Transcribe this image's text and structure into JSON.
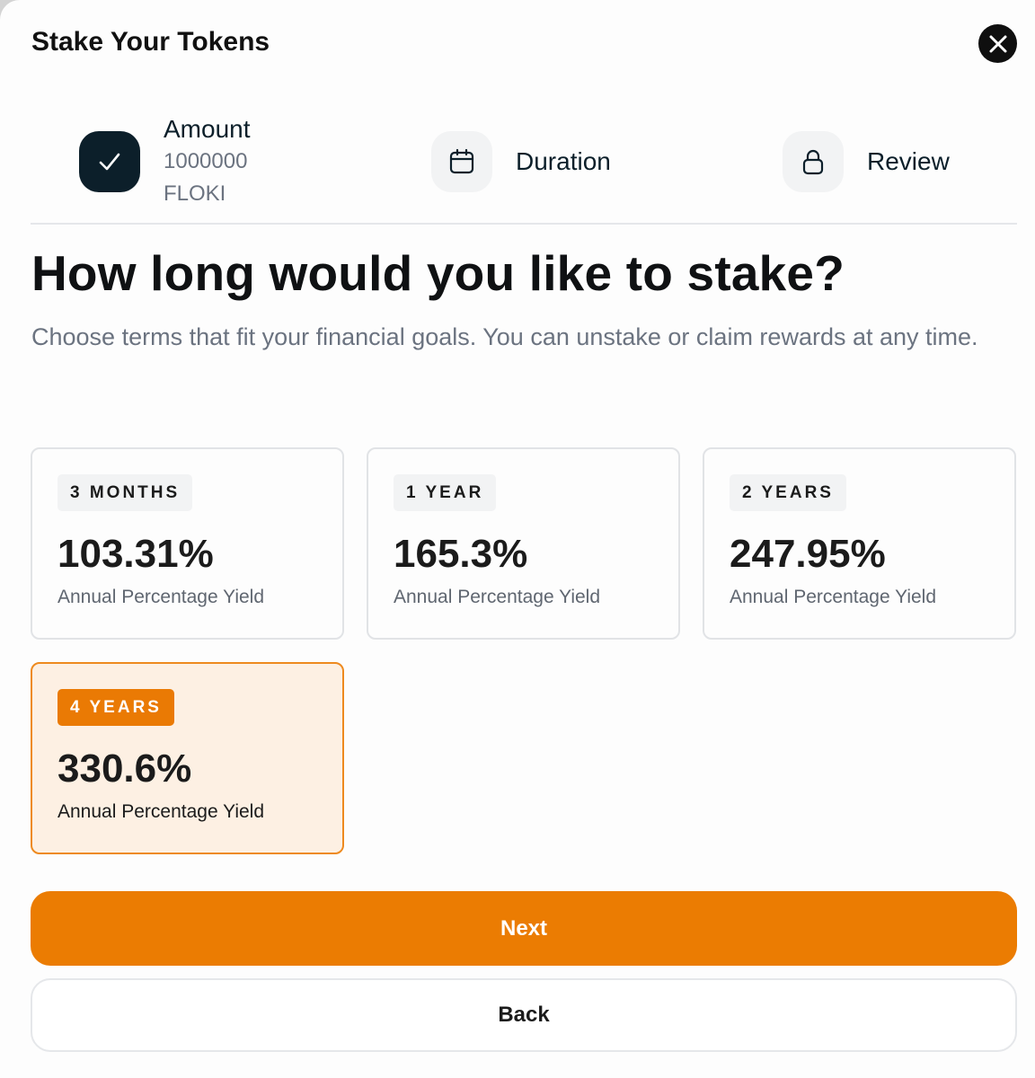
{
  "header": {
    "title": "Stake Your Tokens",
    "close_icon": "close-icon"
  },
  "steps": [
    {
      "label": "Amount",
      "sub_value": "1000000",
      "sub_unit": "FLOKI",
      "icon": "check-icon",
      "state": "done"
    },
    {
      "label": "Duration",
      "icon": "calendar-icon",
      "state": "current"
    },
    {
      "label": "Review",
      "icon": "lock-icon",
      "state": "upcoming"
    }
  ],
  "main": {
    "heading": "How long would you like to stake?",
    "subheading": "Choose terms that fit your financial goals. You can unstake or claim rewards at any time."
  },
  "options": [
    {
      "term": "3 MONTHS",
      "apy": "103.31%",
      "apy_label": "Annual Percentage Yield",
      "selected": false
    },
    {
      "term": "1 YEAR",
      "apy": "165.3%",
      "apy_label": "Annual Percentage Yield",
      "selected": false
    },
    {
      "term": "2 YEARS",
      "apy": "247.95%",
      "apy_label": "Annual Percentage Yield",
      "selected": false
    },
    {
      "term": "4 YEARS",
      "apy": "330.6%",
      "apy_label": "Annual Percentage Yield",
      "selected": true
    }
  ],
  "actions": {
    "next_label": "Next",
    "back_label": "Back"
  },
  "colors": {
    "accent": "#eb7c02",
    "selected_bg": "#fdf0e3",
    "dark": "#0c1f2a"
  }
}
